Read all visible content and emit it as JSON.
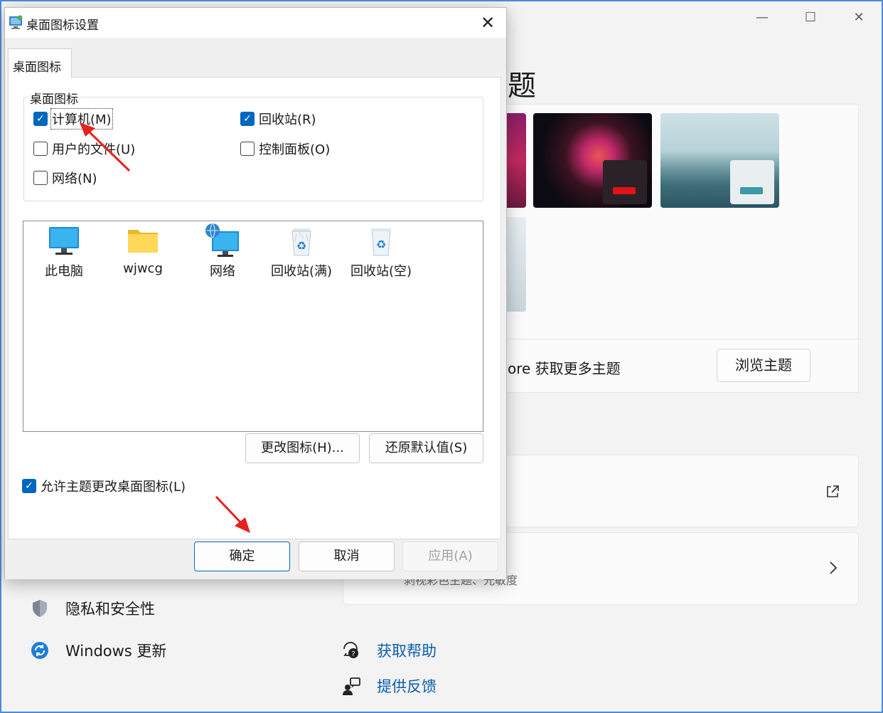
{
  "settings": {
    "heading_fragment": "题",
    "store_text_fragment": "ore 获取更多主题",
    "browse_button": "浏览主题",
    "card2_subtitle_fragment": "剥视彩色主题、光敏度",
    "nav": [
      {
        "label": "隐私和安全性",
        "icon": "shield-icon"
      },
      {
        "label": "Windows 更新",
        "icon": "windows-update-icon"
      }
    ],
    "help": [
      {
        "label": "获取帮助",
        "icon": "help-icon"
      },
      {
        "label": "提供反馈",
        "icon": "feedback-icon"
      }
    ],
    "window_controls": {
      "minimize": "—",
      "maximize": "☐",
      "close": "✕"
    }
  },
  "dialog": {
    "title": "桌面图标设置",
    "close_glyph": "✕",
    "tab": "桌面图标",
    "group_label": "桌面图标",
    "checkboxes": [
      {
        "label": "计算机(M)",
        "checked": true
      },
      {
        "label": "回收站(R)",
        "checked": true
      },
      {
        "label": "用户的文件(U)",
        "checked": false
      },
      {
        "label": "控制面板(O)",
        "checked": false
      },
      {
        "label": "网络(N)",
        "checked": false
      }
    ],
    "icons": [
      {
        "label": "此电脑",
        "icon": "monitor-icon"
      },
      {
        "label": "wjwcg",
        "icon": "folder-icon"
      },
      {
        "label": "网络",
        "icon": "network-icon"
      },
      {
        "label": "回收站(满)",
        "icon": "recycle-bin-full-icon"
      },
      {
        "label": "回收站(空)",
        "icon": "recycle-bin-empty-icon"
      }
    ],
    "change_icon_button": "更改图标(H)...",
    "restore_default_button": "还原默认值(S)",
    "allow_themes_label": "允许主题更改桌面图标(L)",
    "allow_themes_checked": true,
    "ok_button": "确定",
    "cancel_button": "取消",
    "apply_button": "应用(A)"
  },
  "colors": {
    "accent": "#0067c0",
    "arrow": "#e8211c"
  }
}
